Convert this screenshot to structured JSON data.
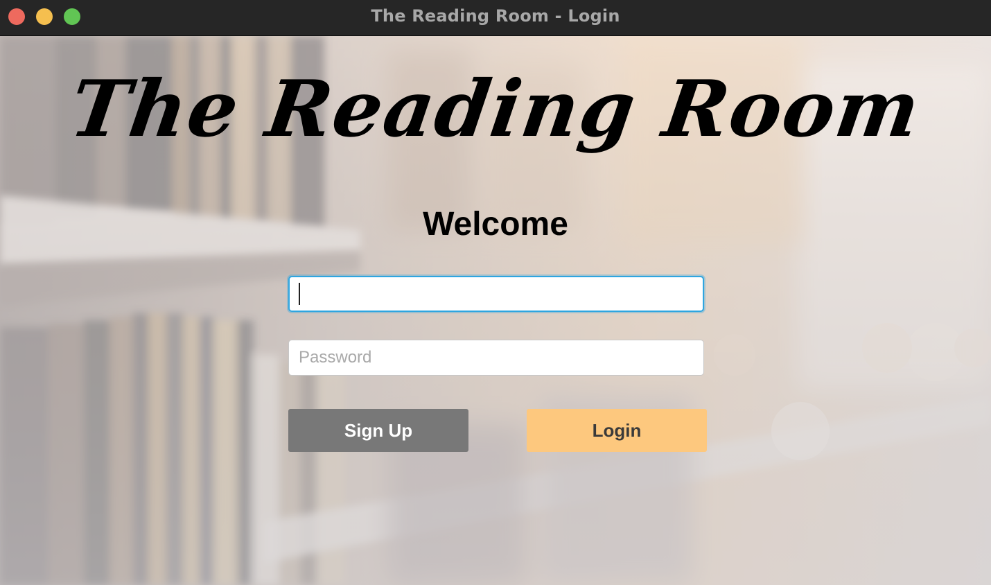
{
  "window": {
    "title": "The Reading Room - Login"
  },
  "main": {
    "brand_title": "The Reading Room",
    "welcome_text": "Welcome"
  },
  "form": {
    "username": {
      "value": "",
      "placeholder": ""
    },
    "password": {
      "value": "",
      "placeholder": "Password"
    },
    "signup_label": "Sign Up",
    "login_label": "Login"
  },
  "colors": {
    "titlebar": "#262626",
    "signup_button": "#787878",
    "login_button": "#fdc87e",
    "focus_ring": "#2ea5e0"
  },
  "icons": {
    "close": "traffic-light-close",
    "minimize": "traffic-light-minimize",
    "maximize": "traffic-light-maximize",
    "background": "library-bookshelf-background"
  }
}
